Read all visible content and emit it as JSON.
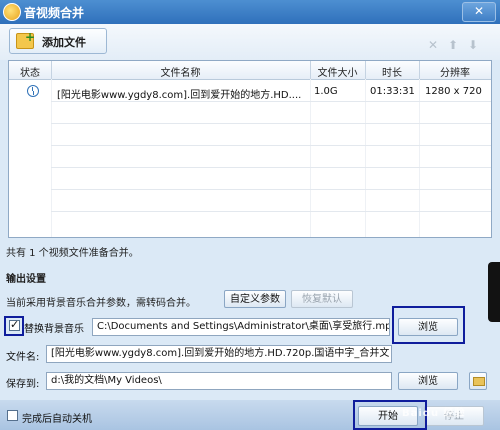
{
  "window": {
    "title": "音视频合并",
    "close": "✕"
  },
  "toolbar": {
    "add_label": "添加文件",
    "icons": [
      "delete-icon",
      "arrow-up-icon",
      "arrow-down-icon"
    ],
    "delete_glyph": "✕",
    "up_glyph": "⬆",
    "down_glyph": "⬇"
  },
  "table": {
    "columns": [
      "状态",
      "文件名称",
      "文件大小",
      "时长",
      "分辨率"
    ],
    "rows": [
      {
        "status": "clock-icon",
        "name": "[阳光电影www.ygdy8.com].回到爱开始的地方.HD....",
        "size": "1.0G",
        "duration": "01:33:31",
        "resolution": "1280 x 720"
      }
    ]
  },
  "summary": "共有 1 个视频文件准备合并。",
  "output": {
    "heading": "输出设置",
    "note": "当前采用背景音乐合并参数，需转码合并。",
    "custom_btn": "自定义参数",
    "restore_btn": "恢复默认",
    "replace_music": {
      "label": "替换背景音乐",
      "checked": true,
      "check_glyph": "✓",
      "value": "C:\\Documents and Settings\\Administrator\\桌面\\享受旅行.mp3",
      "browse": "浏览"
    },
    "filename": {
      "label": "文件名:",
      "value": "[阳光电影www.ygdy8.com].回到爱开始的地方.HD.720p.国语中字_合并文"
    },
    "save_to": {
      "label": "保存到:",
      "value": "d:\\我的文档\\My Videos\\",
      "browse": "浏览"
    }
  },
  "footer": {
    "auto_shutdown": "完成后自动关机",
    "start": "开始",
    "stop": "停止"
  },
  "watermark": "Baidu 经验",
  "colors": {
    "titlebar": "#2f70bb",
    "highlight": "#0f1d9c",
    "panel": "#dbe9f6"
  }
}
